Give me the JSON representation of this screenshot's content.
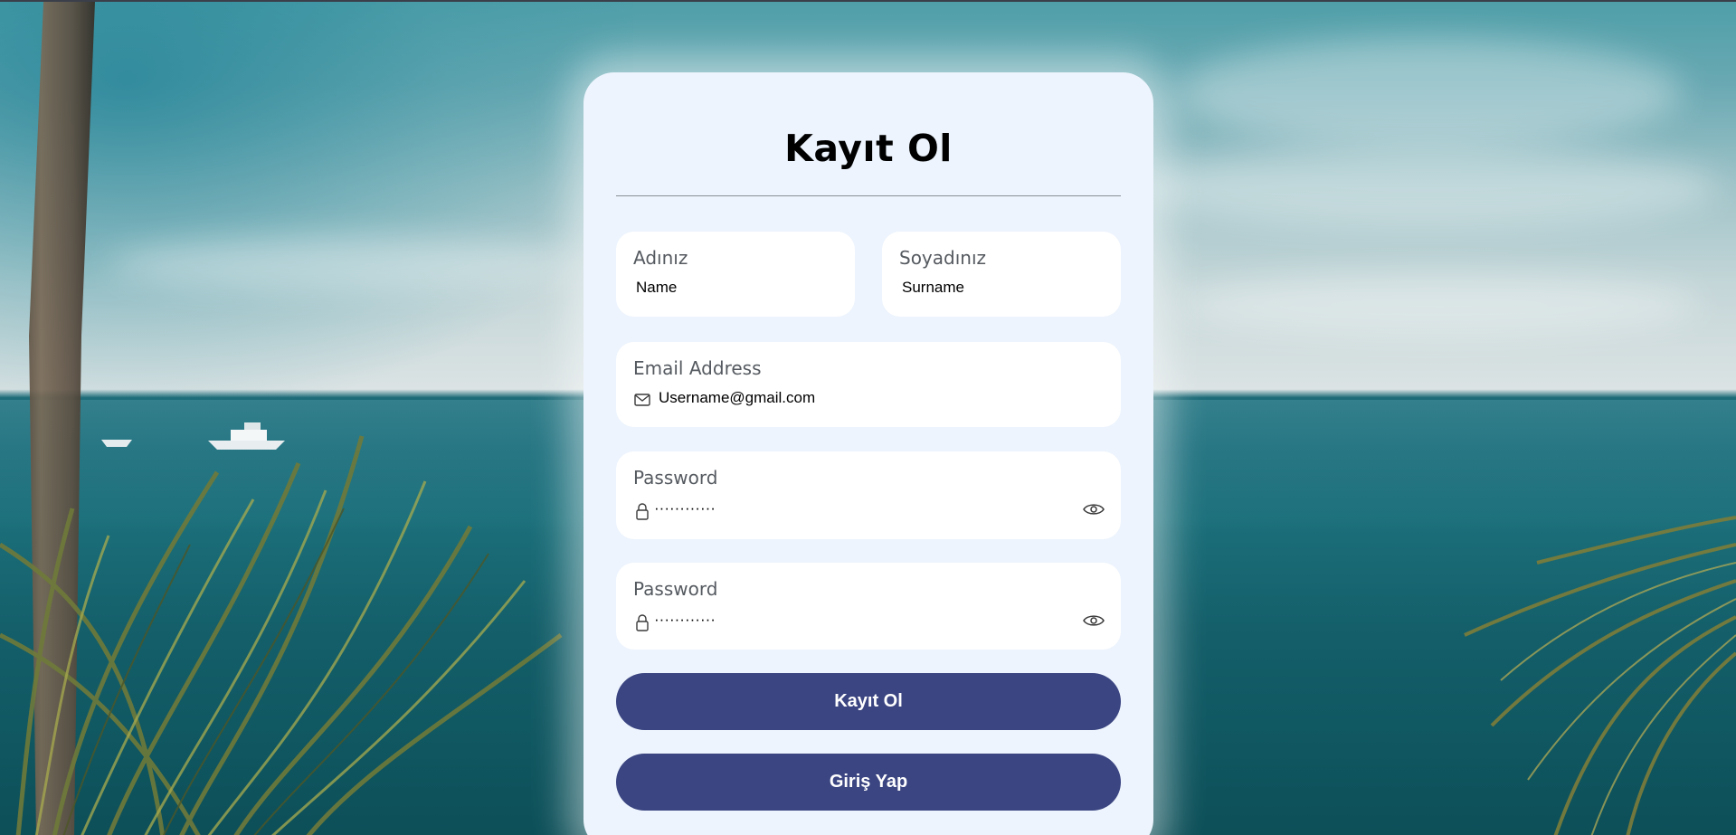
{
  "form": {
    "title": "Kayıt Ol",
    "first_name": {
      "label": "Adınız",
      "value": "Name"
    },
    "last_name": {
      "label": "Soyadınız",
      "value": "Surname"
    },
    "email": {
      "label": "Email Address",
      "value": "Username@gmail.com",
      "icon": "envelope-icon"
    },
    "password": {
      "label": "Password",
      "value": "············",
      "icon": "lock-icon",
      "toggle_icon": "eye-icon"
    },
    "password_confirm": {
      "label": "Password",
      "value": "············",
      "icon": "lock-icon",
      "toggle_icon": "eye-icon"
    },
    "register_button": "Kayıt Ol",
    "login_button": "Giriş Yap"
  },
  "colors": {
    "card_background": "#edf4fd",
    "button_background": "#3b4581",
    "button_text": "#ffffff"
  }
}
